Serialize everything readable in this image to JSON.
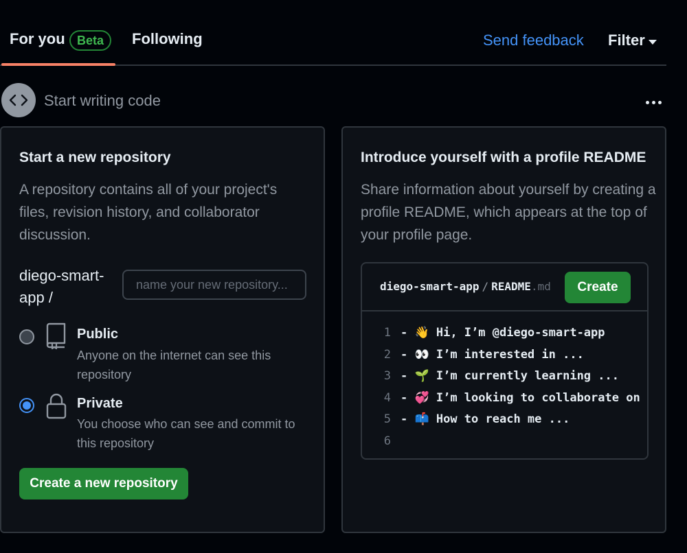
{
  "tabs": {
    "for_you": "For you",
    "beta": "Beta",
    "following": "Following"
  },
  "header": {
    "send_feedback": "Send feedback",
    "filter": "Filter"
  },
  "section": {
    "title": "Start writing code"
  },
  "new_repo": {
    "title": "Start a new repository",
    "description": "A repository contains all of your project's files, revision history, and collaborator discussion.",
    "owner": "diego-smart-app /",
    "input_placeholder": "name your new repository...",
    "public": {
      "title": "Public",
      "description": "Anyone on the internet can see this repository",
      "selected": false
    },
    "private": {
      "title": "Private",
      "description": "You choose who can see and commit to this repository",
      "selected": true
    },
    "create_button": "Create a new repository"
  },
  "readme": {
    "title": "Introduce yourself with a profile README",
    "description": "Share information about yourself by creating a profile README, which appears at the top of your profile page.",
    "path_owner": "diego-smart-app",
    "path_sep": "/",
    "path_file": "README",
    "path_ext": ".md",
    "create_button": "Create",
    "lines": [
      {
        "num": "1",
        "text": "- 👋 Hi, I’m @diego-smart-app"
      },
      {
        "num": "2",
        "text": "- 👀 I’m interested in ..."
      },
      {
        "num": "3",
        "text": "- 🌱 I’m currently learning ..."
      },
      {
        "num": "4",
        "text": "- 💞️ I’m looking to collaborate on ..."
      },
      {
        "num": "5",
        "text": "- 📫 How to reach me ..."
      },
      {
        "num": "6",
        "text": ""
      }
    ]
  },
  "colors": {
    "background": "#010409",
    "card": "#0d1117",
    "border": "#30363d",
    "accent_blue": "#4493f8",
    "green_button": "#238636",
    "tab_underline": "#f78166"
  }
}
